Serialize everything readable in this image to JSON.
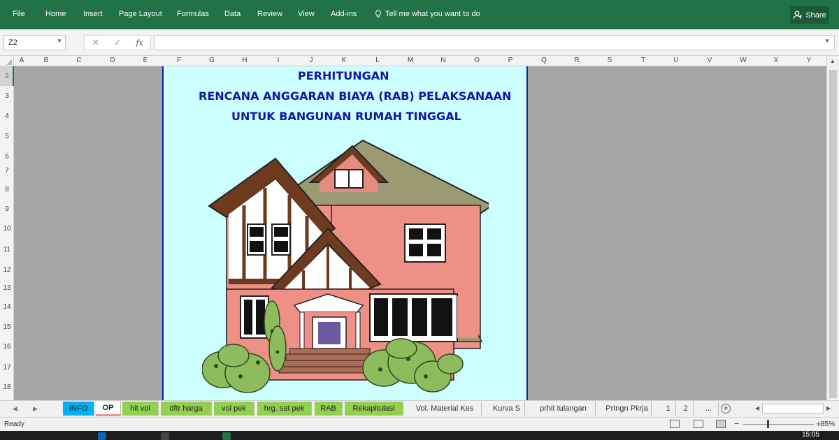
{
  "ribbon": {
    "tabs": [
      "File",
      "Home",
      "Insert",
      "Page Layout",
      "Formulas",
      "Data",
      "Review",
      "View",
      "Add-ins"
    ],
    "tell_me": "Tell me what you want to do",
    "share": "Share"
  },
  "formula_bar": {
    "name_box": "Z2",
    "cancel_symbol": "✕",
    "enter_symbol": "✓",
    "fx_symbol": "fx",
    "formula_value": ""
  },
  "columns": [
    "A",
    "B",
    "C",
    "D",
    "E",
    "F",
    "G",
    "H",
    "I",
    "J",
    "K",
    "L",
    "M",
    "N",
    "O",
    "P",
    "Q",
    "R",
    "S",
    "T",
    "U",
    "V",
    "W",
    "X",
    "Y"
  ],
  "rows": [
    "2",
    "3",
    "4",
    "5",
    "6",
    "7",
    "8",
    "9",
    "10",
    "11",
    "12",
    "13",
    "14",
    "15",
    "16",
    "17",
    "18"
  ],
  "document": {
    "line1": "PERHITUNGAN",
    "line2": "RENCANA ANGGARAN BIAYA (RAB) PELAKSANAAN",
    "line3": "UNTUK BANGUNAN RUMAH TINGGAL",
    "title_color": "#1414a8",
    "page_background": "#ccffff",
    "illustration": "house-illustration"
  },
  "sheet_tabs": [
    {
      "label": "INFO",
      "style": "cyan"
    },
    {
      "label": "OP",
      "style": "active"
    },
    {
      "label": "hit vol",
      "style": "green"
    },
    {
      "label": "dftr harga",
      "style": "green"
    },
    {
      "label": "vol pek",
      "style": "green"
    },
    {
      "label": "hrg. sat pek",
      "style": "green"
    },
    {
      "label": "RAB",
      "style": "green"
    },
    {
      "label": "Rekapitulasi",
      "style": "green"
    },
    {
      "label": "Vol. Material Kes",
      "style": "plain"
    },
    {
      "label": "Kurva S",
      "style": "plain"
    },
    {
      "label": "prhit tulangan",
      "style": "plain"
    },
    {
      "label": "Prtngn Pkrja",
      "style": "plain"
    },
    {
      "label": "1",
      "style": "plain"
    },
    {
      "label": "2",
      "style": "plain"
    },
    {
      "label": "...",
      "style": "plain"
    }
  ],
  "status_bar": {
    "ready": "Ready",
    "zoom": "85%",
    "zoom_fraction": 0.34
  },
  "taskbar": {
    "clock": "15:05"
  },
  "colors": {
    "excel_green": "#217346",
    "tab_green": "#92d050",
    "tab_cyan": "#00b0f0"
  }
}
